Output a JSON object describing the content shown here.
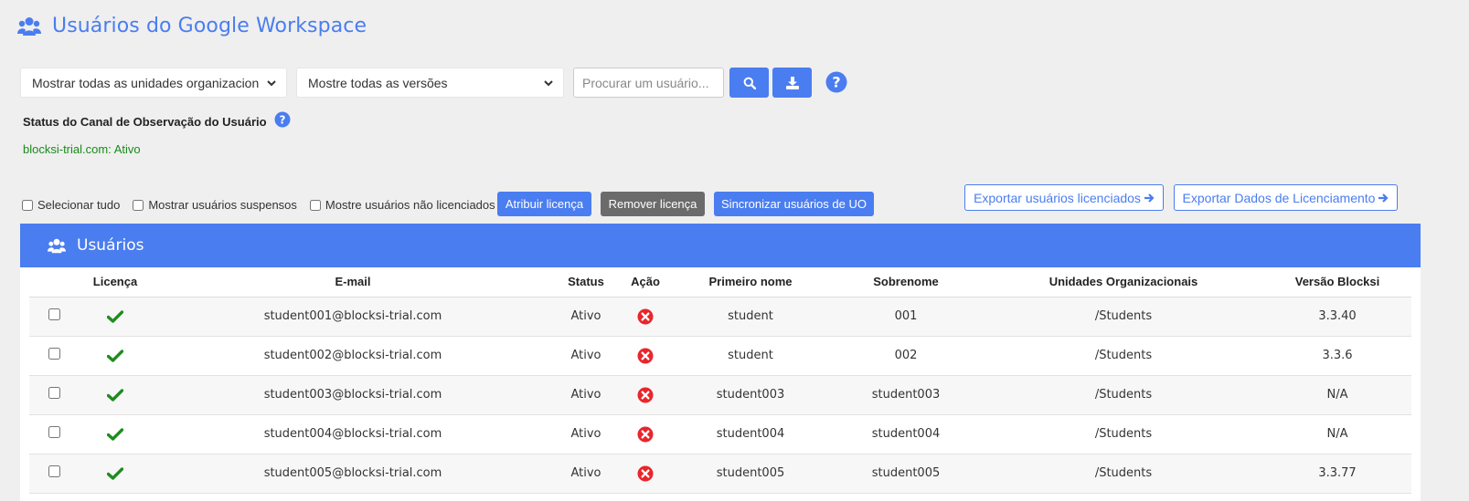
{
  "page": {
    "title": "Usuários do Google Workspace",
    "title_icon": "users-icon"
  },
  "filters": {
    "org_units_select": "Mostrar todas as unidades organizacion",
    "versions_select": "Mostre todas as versões",
    "search_placeholder": "Procurar um usuário...",
    "search_icon": "search-icon",
    "download_icon": "download-icon",
    "help_icon": "help-icon"
  },
  "observation": {
    "title": "Status do Canal de Observação do Usuário",
    "status": "blocksi-trial.com: Ativo"
  },
  "options": {
    "select_all": "Selecionar tudo",
    "show_suspended": "Mostrar usuários suspensos",
    "show_unlicensed": "Mostre usuários não licenciados"
  },
  "actions": {
    "assign_license": "Atribuir licença",
    "remove_license": "Remover licença",
    "sync_ou": "Sincronizar usuários de UO",
    "export_licensed": "Exportar usuários licenciados",
    "export_licensing_data": "Exportar Dados de Licenciamento"
  },
  "colors": {
    "accent": "#4a7df0",
    "status_green": "#1a8a1a",
    "remove_gray": "#6b6b6b",
    "action_red": "#e8262b"
  },
  "panel": {
    "title": "Usuários",
    "columns": [
      "Licença",
      "E-mail",
      "Status",
      "Ação",
      "Primeiro nome",
      "Sobrenome",
      "Unidades Organizacionais",
      "Versão Blocksi"
    ]
  },
  "rows": [
    {
      "email": "student001@blocksi-trial.com",
      "status": "Ativo",
      "first": "student",
      "last": "001",
      "ou": "/Students",
      "version": "3.3.40"
    },
    {
      "email": "student002@blocksi-trial.com",
      "status": "Ativo",
      "first": "student",
      "last": "002",
      "ou": "/Students",
      "version": "3.3.6"
    },
    {
      "email": "student003@blocksi-trial.com",
      "status": "Ativo",
      "first": "student003",
      "last": "student003",
      "ou": "/Students",
      "version": "N/A"
    },
    {
      "email": "student004@blocksi-trial.com",
      "status": "Ativo",
      "first": "student004",
      "last": "student004",
      "ou": "/Students",
      "version": "N/A"
    },
    {
      "email": "student005@blocksi-trial.com",
      "status": "Ativo",
      "first": "student005",
      "last": "student005",
      "ou": "/Students",
      "version": "3.3.77"
    }
  ]
}
